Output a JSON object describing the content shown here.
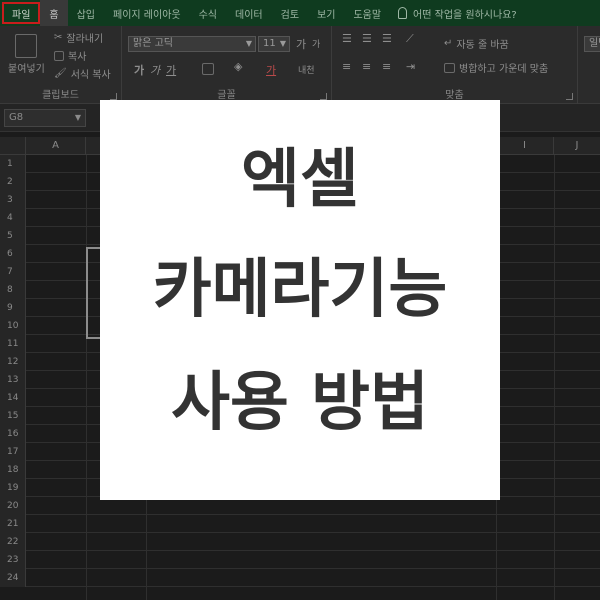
{
  "ribbon_tabs": [
    {
      "label": "파일"
    },
    {
      "label": "홈"
    },
    {
      "label": "삽입"
    },
    {
      "label": "페이지 레이아웃"
    },
    {
      "label": "수식"
    },
    {
      "label": "데이터"
    },
    {
      "label": "검토"
    },
    {
      "label": "보기"
    },
    {
      "label": "도움말"
    }
  ],
  "tell_me": "어떤 작업을 원하시나요?",
  "clipboard": {
    "paste": "붙여넣기",
    "cut": "잘라내기",
    "copy": "복사",
    "format_painter": "서식 복사",
    "label": "클립보드"
  },
  "font": {
    "name": "맑은 고딕",
    "size": "11",
    "grow": "가",
    "shrink": "가",
    "bold": "가",
    "italic": "가",
    "underline": "가",
    "font_color": "가",
    "phonetic": "내천",
    "label": "글꼴"
  },
  "alignment": {
    "wrap_text": "자동 줄 바꿈",
    "merge_center": "병합하고 가운데 맞춤",
    "label": "맞춤"
  },
  "number": {
    "format_label": "일반"
  },
  "name_box": "G8",
  "columns": [
    "A",
    "I",
    "J"
  ],
  "rows": [
    "1",
    "2",
    "3",
    "4",
    "5",
    "6",
    "7",
    "8",
    "9",
    "10",
    "11",
    "12",
    "13",
    "14",
    "15",
    "16",
    "17",
    "18",
    "19",
    "20",
    "21",
    "22",
    "23",
    "24"
  ],
  "overlay": {
    "line1": "엑셀",
    "line2": "카메라기능",
    "line3": "사용 방법"
  },
  "colors": {
    "tabbar_bg": "#0f3b1f",
    "file_tab_border": "#c81d1d",
    "card_bg": "#ffffff",
    "card_text": "#333333"
  }
}
